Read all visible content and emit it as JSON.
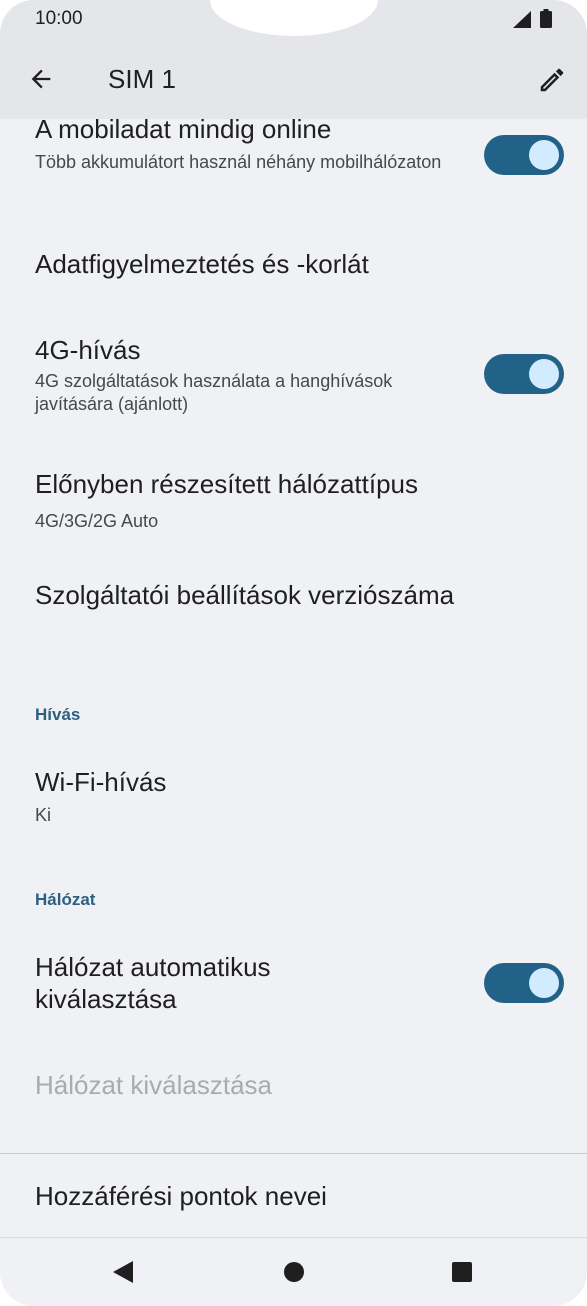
{
  "status_bar": {
    "time": "10:00",
    "signal_icon": "signal-icon",
    "battery_icon": "battery-icon"
  },
  "toolbar": {
    "title": "SIM 1",
    "back_icon": "arrow-back-icon",
    "edit_icon": "pencil-icon"
  },
  "settings": {
    "always_online": {
      "title": "A mobiladat mindig online",
      "summary": "Több akkumulátort használ néhány mobilhálózaton",
      "toggle_on": true
    },
    "data_warning": {
      "title": "Adatfigyelmeztetés és -korlát"
    },
    "call_4g": {
      "title": "4G-hívás",
      "summary": "4G szolgáltatások használata a hanghívások javítására (ajánlott)",
      "toggle_on": true
    },
    "preferred_network": {
      "title": "Előnyben részesített hálózattípus",
      "summary": "4G/3G/2G Auto"
    },
    "carrier_settings_version": {
      "title": "Szolgáltatói beállítások verziószáma"
    },
    "section_calling": "Hívás",
    "wifi_calling": {
      "title": "Wi-Fi-hívás",
      "summary": "Ki"
    },
    "section_network": "Hálózat",
    "auto_network": {
      "title": "Hálózat automatikus kiválasztása",
      "toggle_on": true
    },
    "choose_network": {
      "title": "Hálózat kiválasztása",
      "enabled": false
    },
    "apn": {
      "title": "Hozzáférési pontok nevei"
    }
  },
  "nav_bar": {
    "back_icon": "triangle-back-icon",
    "home_icon": "circle-home-icon",
    "recents_icon": "square-recents-icon"
  },
  "colors": {
    "background": "#eff1f4",
    "toolbar": "#e4e6e9",
    "accent": "#236288",
    "toggle_knob": "#d2ebff",
    "section_header": "#2d5f83"
  }
}
